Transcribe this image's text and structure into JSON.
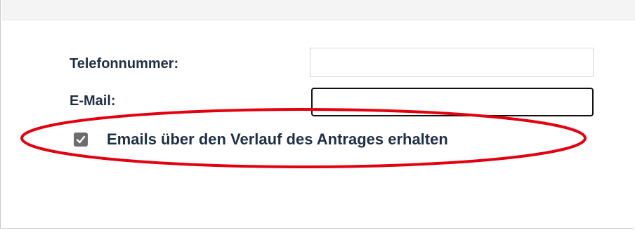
{
  "form": {
    "phone": {
      "label": "Telefonnummer:",
      "value": "",
      "placeholder": ""
    },
    "email": {
      "label": "E-Mail:",
      "value": "",
      "placeholder": ""
    },
    "email_updates": {
      "label": "Emails über den Verlauf des Antrages erhalten",
      "checked": true
    }
  },
  "annotation": {
    "highlight_color": "#e3000f",
    "target": "email-updates-checkbox"
  },
  "colors": {
    "label_text": "#1f2f45",
    "checkbox_fill": "#6d6d6d",
    "focus_border": "#111111"
  }
}
